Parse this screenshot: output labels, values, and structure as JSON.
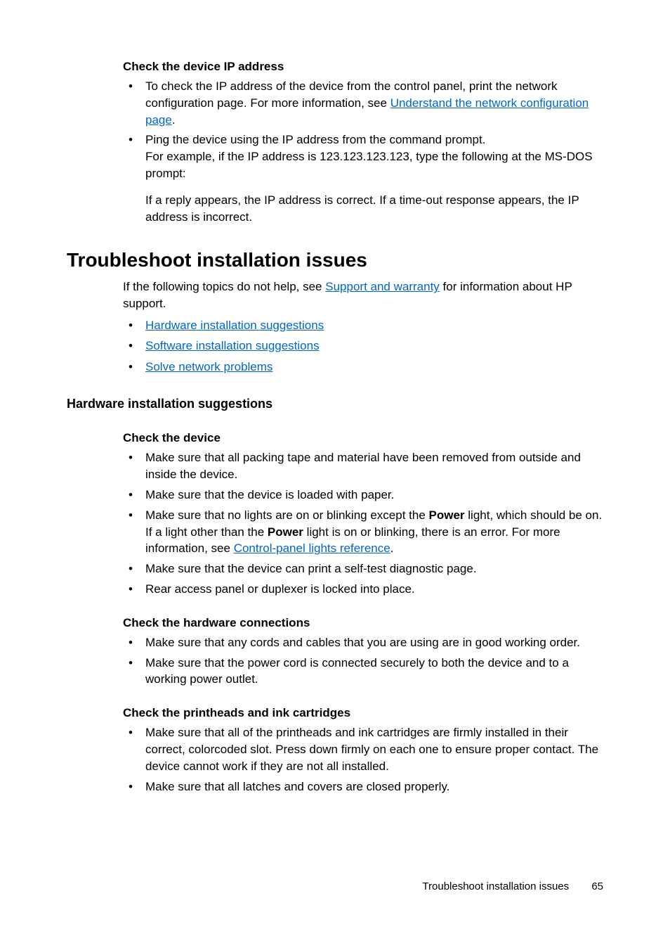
{
  "sec1": {
    "heading": "Check the device IP address",
    "bullet1a": "To check the IP address of the device from the control panel, print the network configuration page. For more information, see ",
    "link1": "Understand the network configuration page",
    "bullet1b": ".",
    "bullet2a": "Ping the device using the IP address from the command prompt.",
    "bullet2b": "For example, if the IP address is 123.123.123.123, type the following at the MS-DOS prompt:",
    "bullet2c": "If a reply appears, the IP address is correct. If a time-out response appears, the IP address is incorrect."
  },
  "title": "Troubleshoot installation issues",
  "intro_a": "If the following topics do not help, see ",
  "intro_link": "Support and warranty",
  "intro_b": " for information about HP support.",
  "links": {
    "l1": "Hardware installation suggestions",
    "l2": "Software installation suggestions",
    "l3": "Solve network problems"
  },
  "subsection": "Hardware installation suggestions",
  "checkDevice": {
    "heading": "Check the device",
    "b1": "Make sure that all packing tape and material have been removed from outside and inside the device.",
    "b2": "Make sure that the device is loaded with paper.",
    "b3a": "Make sure that no lights are on or blinking except the ",
    "b3_pow1": "Power",
    "b3b": " light, which should be on. If a light other than the ",
    "b3_pow2": "Power",
    "b3c": " light is on or blinking, there is an error. For more information, see ",
    "b3_link": "Control-panel lights reference",
    "b3d": ".",
    "b4": "Make sure that the device can print a self-test diagnostic page.",
    "b5": "Rear access panel or duplexer is locked into place."
  },
  "checkHw": {
    "heading": "Check the hardware connections",
    "b1": "Make sure that any cords and cables that you are using are in good working order.",
    "b2": "Make sure that the power cord is connected securely to both the device and to a working power outlet."
  },
  "checkInk": {
    "heading": "Check the printheads and ink cartridges",
    "b1": "Make sure that all of the printheads and ink cartridges are firmly installed in their correct, colorcoded slot. Press down firmly on each one to ensure proper contact. The device cannot work if they are not all installed.",
    "b2": "Make sure that all latches and covers are closed properly."
  },
  "footer": {
    "text": "Troubleshoot installation issues",
    "page": "65"
  }
}
